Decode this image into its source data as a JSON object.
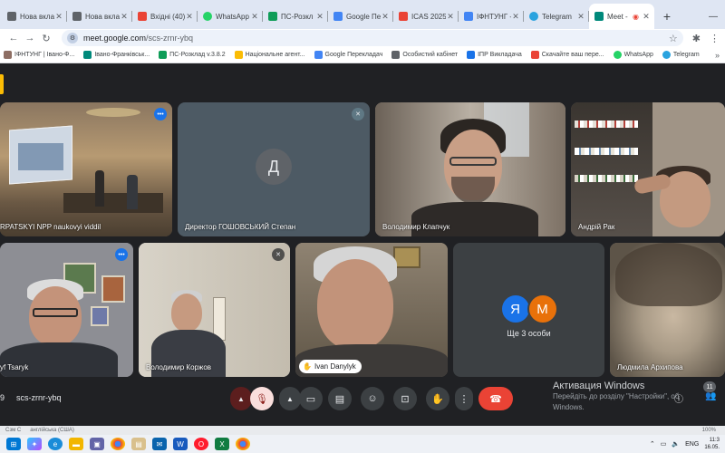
{
  "browser": {
    "tabs": [
      {
        "label": "Нова вкла",
        "color": "#5f6368"
      },
      {
        "label": "Нова вкла",
        "color": "#5f6368"
      },
      {
        "label": "Вхідні (40)",
        "color": "#ea4335"
      },
      {
        "label": "WhatsApp",
        "color": "#25d366"
      },
      {
        "label": "ПС-Розкл",
        "color": "#0f9d58"
      },
      {
        "label": "Google Пер",
        "color": "#4285f4"
      },
      {
        "label": "ICAS 2025",
        "color": "#ea4335"
      },
      {
        "label": "ІФНТУНГ -",
        "color": "#4285f4"
      },
      {
        "label": "Telegram",
        "color": "#2aa3df"
      },
      {
        "label": "Meet -",
        "color": "#00897b"
      }
    ],
    "new_tab": "+",
    "url_host": "meet.google.com",
    "url_path": "/scs-zrnr-ybq",
    "bookmarks": [
      {
        "label": "ІФНТУНГ | Івано-Ф...",
        "color": "#8d6e63"
      },
      {
        "label": "Івано-Франківськ...",
        "color": "#00897b"
      },
      {
        "label": "ПС-Розклад v.3.8.2",
        "color": "#0f9d58"
      },
      {
        "label": "Національне агент...",
        "color": "#fbbc04"
      },
      {
        "label": "Google Перекладач",
        "color": "#4285f4"
      },
      {
        "label": "Особистий кабінет",
        "color": "#5f6368"
      },
      {
        "label": "ІПР Викладача",
        "color": "#1a73e8"
      },
      {
        "label": "Скачайте ваш пере...",
        "color": "#ea4335"
      },
      {
        "label": "WhatsApp",
        "color": "#25d366"
      },
      {
        "label": "Telegram",
        "color": "#2aa3df"
      }
    ],
    "bookmarks_more": "»"
  },
  "meet": {
    "tiles": [
      {
        "name": "RPATSKYI NPP naukovyi viddil"
      },
      {
        "name": "Директор ГОШОВСЬКИЙ Степан",
        "avatar_letter": "Д"
      },
      {
        "name": "Володимир Клапчук"
      },
      {
        "name": "Андрій Рак"
      },
      {
        "name": "yf Tsaryk"
      },
      {
        "name": "Володимир Коржов"
      },
      {
        "name": "Ivan Danylyk"
      },
      {
        "name": "Ще 3 особи",
        "avatars": [
          "Я",
          "М"
        ]
      },
      {
        "name": "Людмила Архипова"
      }
    ],
    "meeting_time": "9",
    "meeting_code": "scs-zrnr-ybq",
    "participant_count": "11"
  },
  "windows": {
    "activation_title": "Активация Windows",
    "activation_line1": "Перейдіть до розділу \"Настройки\", об",
    "activation_line2": "Windows.",
    "status_left": "Сзм С",
    "status_lang_text": "англійська (США)",
    "status_right": "100%",
    "lang": "ENG",
    "time": "11:3",
    "date": "16.05."
  }
}
